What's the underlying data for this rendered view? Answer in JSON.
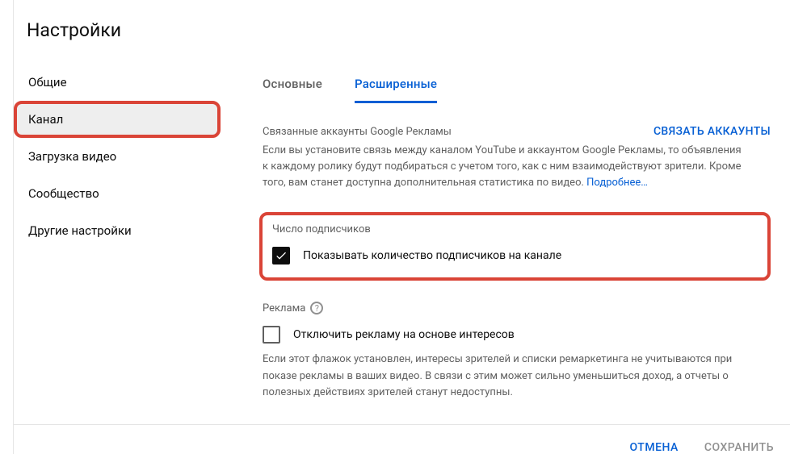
{
  "title": "Настройки",
  "sidebar": {
    "items": [
      {
        "label": "Общие"
      },
      {
        "label": "Канал"
      },
      {
        "label": "Загрузка видео"
      },
      {
        "label": "Сообщество"
      },
      {
        "label": "Другие настройки"
      }
    ]
  },
  "tabs": {
    "basic": "Основные",
    "advanced": "Расширенные"
  },
  "linked": {
    "label": "Связанные аккаунты Google Рекламы",
    "action": "СВЯЗАТЬ АККАУНТЫ",
    "desc": "Если вы установите связь между каналом YouTube и аккаунтом Google Рекламы, то объявления к каждому ролику будут подбираться с учетом того, как с ним взаимодействуют зрители. Кроме того, вам станет доступна дополнительная статистика по видео. ",
    "more": "Подробнее…"
  },
  "subs": {
    "label": "Число подписчиков",
    "checkbox": "Показывать количество подписчиков на канале"
  },
  "ads": {
    "label": "Реклама",
    "checkbox": "Отключить рекламу на основе интересов",
    "desc": "Если этот флажок установлен, интересы зрителей и списки ремаркетинга не учитываются при показе рекламы в ваших видео. В связи с этим может сильно уменьшиться доход, а отчеты о полезных действиях зрителей станут недоступны."
  },
  "footer": {
    "cancel": "ОТМЕНА",
    "save": "СОХРАНИТЬ"
  }
}
